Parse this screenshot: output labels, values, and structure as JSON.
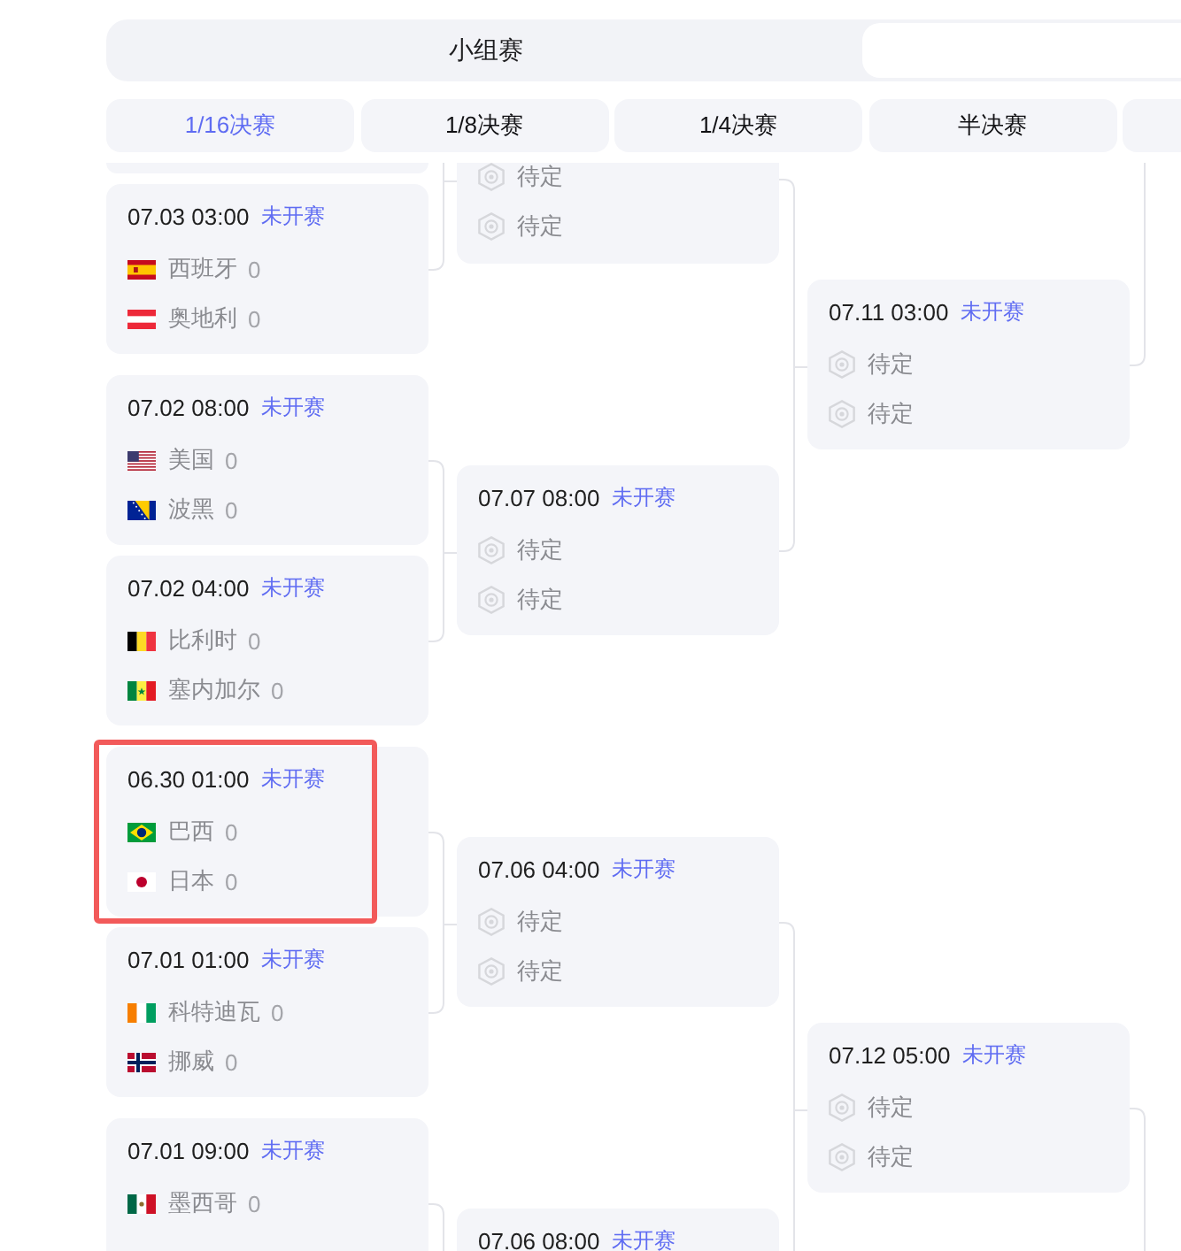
{
  "stage_switch": [
    {
      "label": "小组赛",
      "selected": false
    },
    {
      "selected": true
    }
  ],
  "round_tabs": [
    {
      "label": "1/16决赛",
      "selected": true
    },
    {
      "label": "1/8决赛",
      "selected": false
    },
    {
      "label": "1/4决赛",
      "selected": false
    },
    {
      "label": "半决赛",
      "selected": false
    }
  ],
  "more_tabs_right": true,
  "bracket": {
    "columns": [
      {
        "matches": [
          {
            "kind": "card-bottom",
            "highlighted": false
          },
          {
            "kind": "card",
            "highlighted": false,
            "time": "07.03 03:00",
            "status": "未开赛",
            "teams": [
              {
                "kind": "flag",
                "name": "西班牙",
                "score": "0"
              },
              {
                "kind": "flag",
                "name": "奥地利",
                "score": "0"
              }
            ]
          },
          {
            "kind": "card",
            "highlighted": false,
            "time": "07.02 08:00",
            "status": "未开赛",
            "teams": [
              {
                "kind": "flag",
                "name": "美国",
                "score": "0"
              },
              {
                "kind": "flag",
                "name": "波黑",
                "score": "0"
              }
            ]
          },
          {
            "kind": "card",
            "highlighted": false,
            "time": "07.02 04:00",
            "status": "未开赛",
            "teams": [
              {
                "kind": "flag",
                "name": "比利时",
                "score": "0"
              },
              {
                "kind": "flag",
                "name": "塞内加尔",
                "score": "0"
              }
            ]
          },
          {
            "kind": "card",
            "highlighted": true,
            "time": "06.30 01:00",
            "status": "未开赛",
            "teams": [
              {
                "kind": "flag",
                "name": "巴西",
                "score": "0"
              },
              {
                "kind": "flag",
                "name": "日本",
                "score": "0"
              }
            ]
          },
          {
            "kind": "card",
            "highlighted": false,
            "time": "07.01 01:00",
            "status": "未开赛",
            "teams": [
              {
                "kind": "flag",
                "name": "科特迪瓦",
                "score": "0"
              },
              {
                "kind": "flag",
                "name": "挪威",
                "score": "0"
              }
            ]
          },
          {
            "kind": "card",
            "highlighted": false,
            "time": "07.01 09:00",
            "status": "未开赛",
            "teams": [
              {
                "kind": "flag",
                "name": "墨西哥",
                "score": "0"
              }
            ]
          }
        ]
      },
      {
        "matches": [
          {
            "kind": "card-bottom",
            "highlighted": false,
            "teams": [
              {
                "kind": "placeholder",
                "name": "待定"
              },
              {
                "kind": "placeholder",
                "name": "待定"
              }
            ]
          },
          {
            "kind": "card",
            "highlighted": false,
            "time": "07.07 08:00",
            "status": "未开赛",
            "teams": [
              {
                "kind": "placeholder",
                "name": "待定"
              },
              {
                "kind": "placeholder",
                "name": "待定"
              }
            ]
          },
          {
            "kind": "card",
            "highlighted": false,
            "time": "07.06 04:00",
            "status": "未开赛",
            "teams": [
              {
                "kind": "placeholder",
                "name": "待定"
              },
              {
                "kind": "placeholder",
                "name": "待定"
              }
            ]
          },
          {
            "kind": "card",
            "highlighted": false,
            "time": "07.06 08:00",
            "status": "未开赛"
          }
        ]
      },
      {
        "matches": [
          {
            "kind": "card",
            "highlighted": false,
            "time": "07.11 03:00",
            "status": "未开赛",
            "teams": [
              {
                "kind": "placeholder",
                "name": "待定"
              },
              {
                "kind": "placeholder",
                "name": "待定"
              }
            ]
          },
          {
            "kind": "card",
            "highlighted": false,
            "time": "07.12 05:00",
            "status": "未开赛",
            "teams": [
              {
                "kind": "placeholder",
                "name": "待定"
              },
              {
                "kind": "placeholder",
                "name": "待定"
              }
            ]
          }
        ]
      }
    ]
  }
}
